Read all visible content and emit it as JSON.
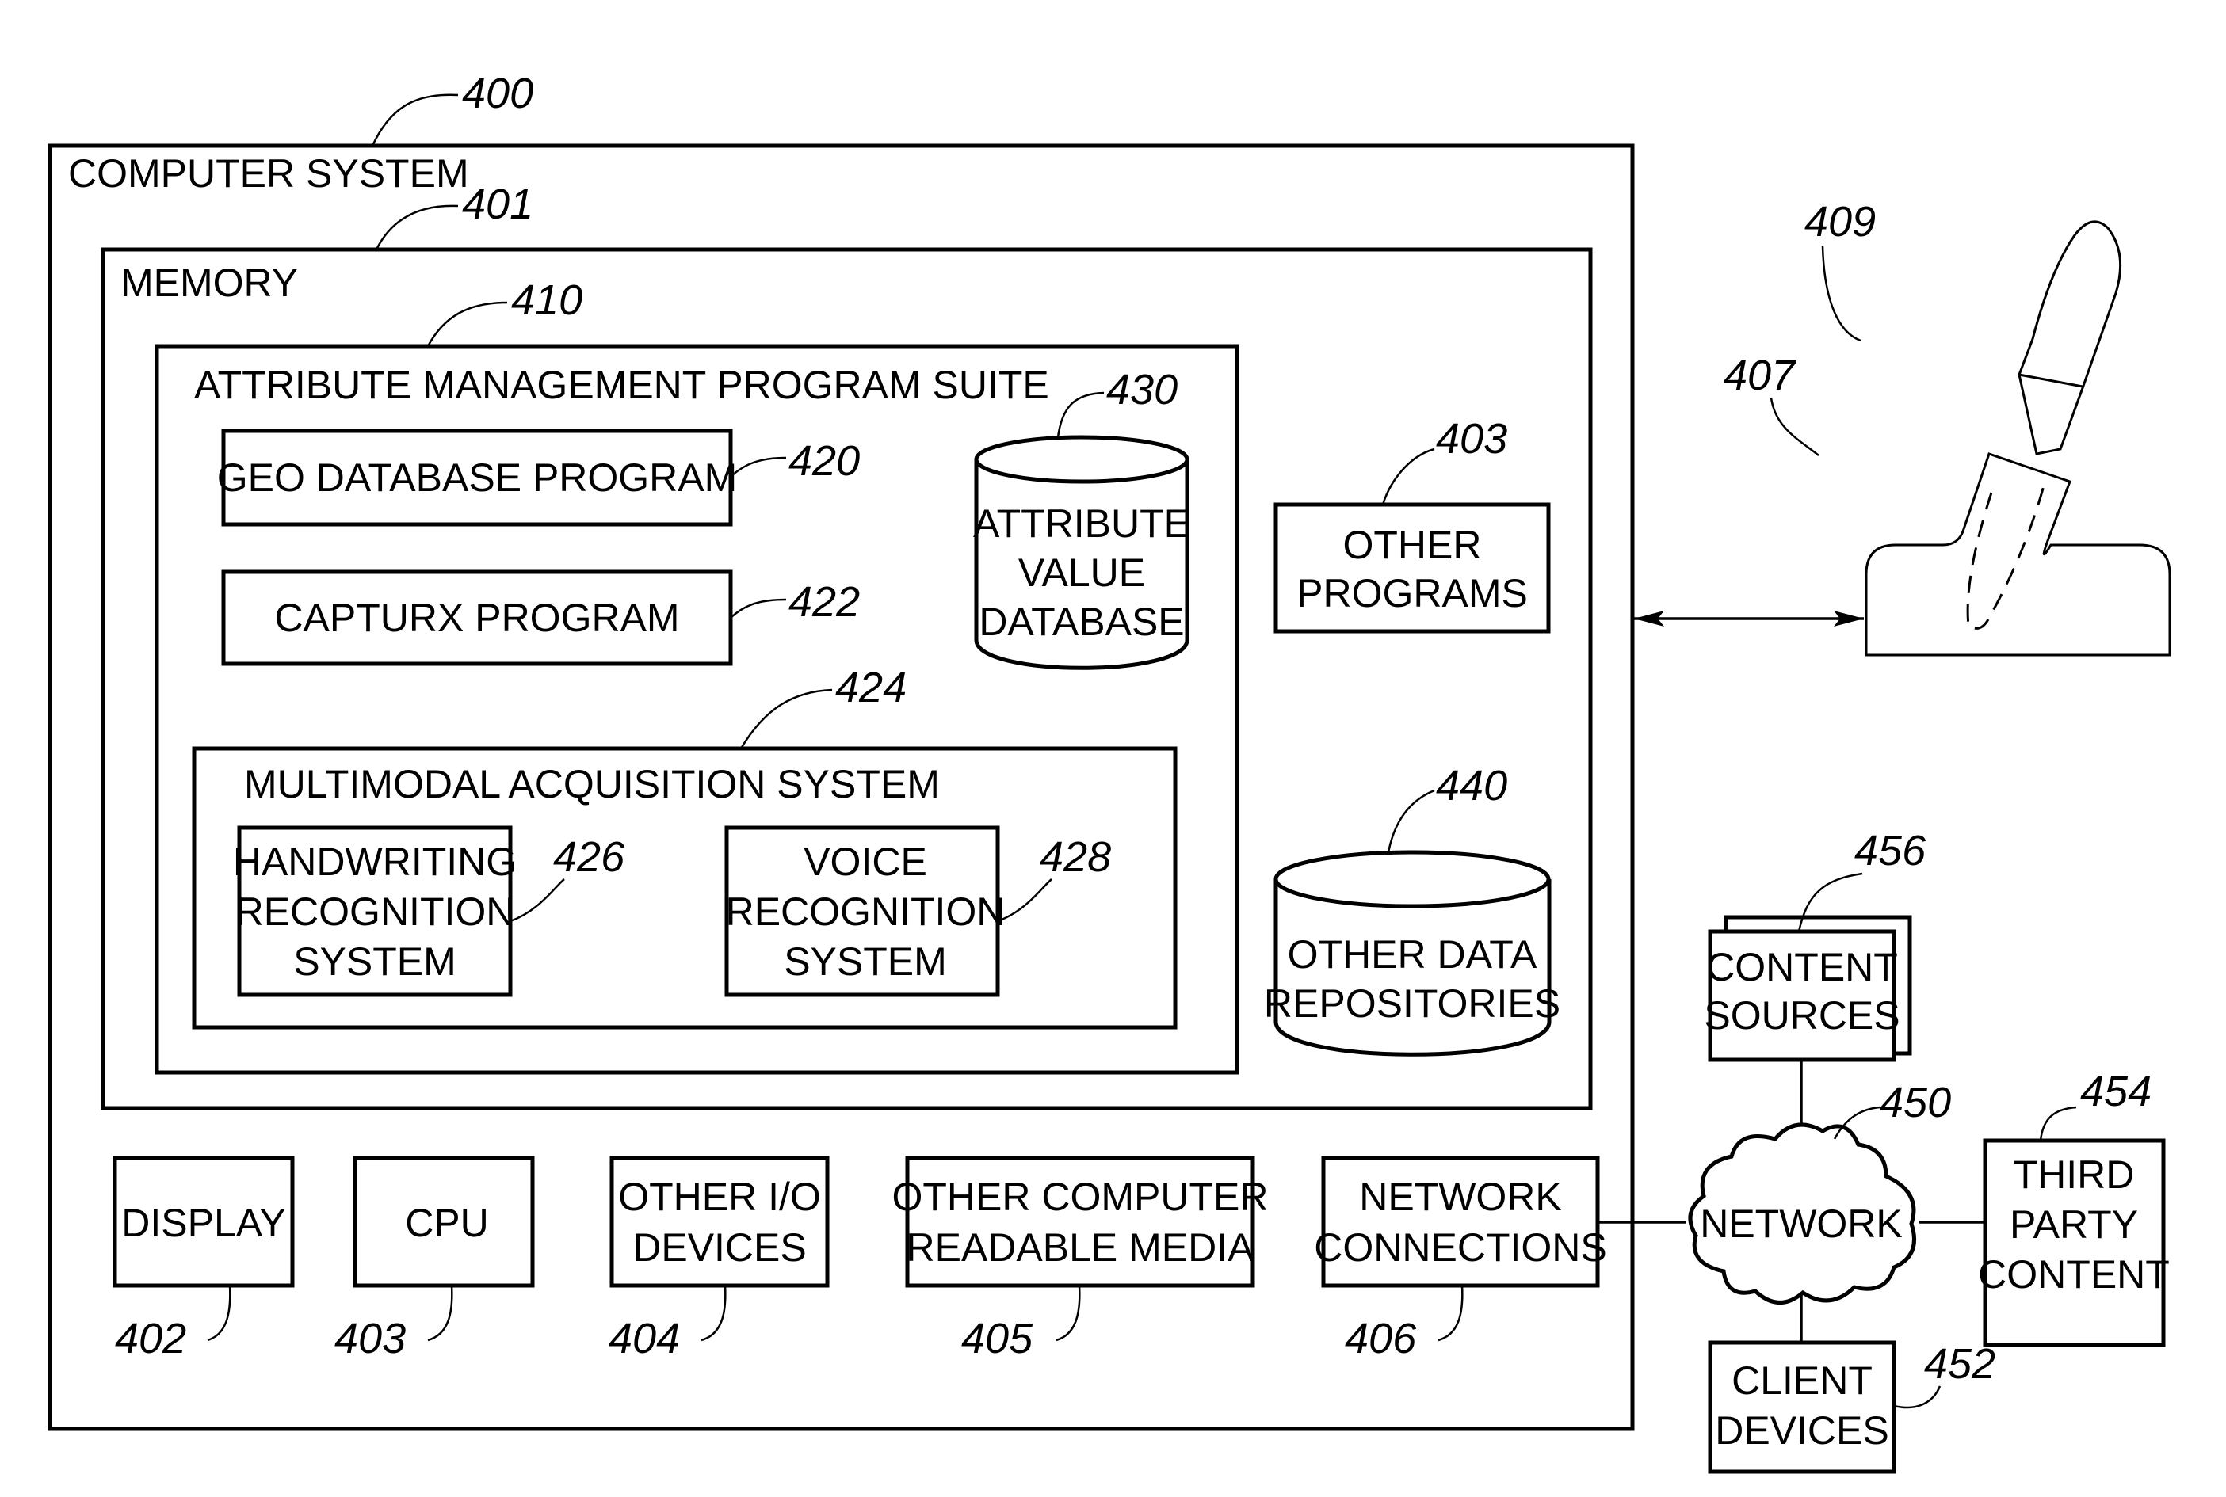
{
  "computer_system": {
    "label": "COMPUTER SYSTEM",
    "ref": "400"
  },
  "memory": {
    "label": "MEMORY",
    "ref": "401"
  },
  "attribute_suite": {
    "label": "ATTRIBUTE MANAGEMENT PROGRAM SUITE",
    "ref": "410"
  },
  "geo_database_program": {
    "label": "GEO DATABASE PROGRAM",
    "ref": "420"
  },
  "capturx_program": {
    "label": "CAPTURX PROGRAM",
    "ref": "422"
  },
  "attribute_value_database": {
    "lines": [
      "ATTRIBUTE",
      "VALUE",
      "DATABASE"
    ],
    "ref": "430"
  },
  "multimodal_system": {
    "label": "MULTIMODAL ACQUISITION SYSTEM",
    "ref": "424"
  },
  "handwriting_recognition": {
    "lines": [
      "HANDWRITING",
      "RECOGNITION",
      "SYSTEM"
    ],
    "ref": "426"
  },
  "voice_recognition": {
    "lines": [
      "VOICE",
      "RECOGNITION",
      "SYSTEM"
    ],
    "ref": "428"
  },
  "other_programs": {
    "lines": [
      "OTHER",
      "PROGRAMS"
    ],
    "ref": "403"
  },
  "other_data_repositories": {
    "lines": [
      "OTHER DATA",
      "REPOSITORIES"
    ],
    "ref": "440"
  },
  "display": {
    "label": "DISPLAY",
    "ref": "402"
  },
  "cpu": {
    "label": "CPU",
    "ref": "403"
  },
  "other_io": {
    "lines": [
      "OTHER I/O",
      "DEVICES"
    ],
    "ref": "404"
  },
  "other_media": {
    "lines": [
      "OTHER COMPUTER",
      "READABLE MEDIA"
    ],
    "ref": "405"
  },
  "network_connections": {
    "lines": [
      "NETWORK",
      "CONNECTIONS"
    ],
    "ref": "406"
  },
  "pen_device": {
    "base_ref": "407",
    "pen_ref": "409"
  },
  "network": {
    "label": "NETWORK",
    "ref": "450"
  },
  "content_sources": {
    "lines": [
      "CONTENT",
      "SOURCES"
    ],
    "ref": "456"
  },
  "third_party_content": {
    "lines": [
      "THIRD",
      "PARTY",
      "CONTENT"
    ],
    "ref": "454"
  },
  "client_devices": {
    "lines": [
      "CLIENT",
      "DEVICES"
    ],
    "ref": "452"
  }
}
